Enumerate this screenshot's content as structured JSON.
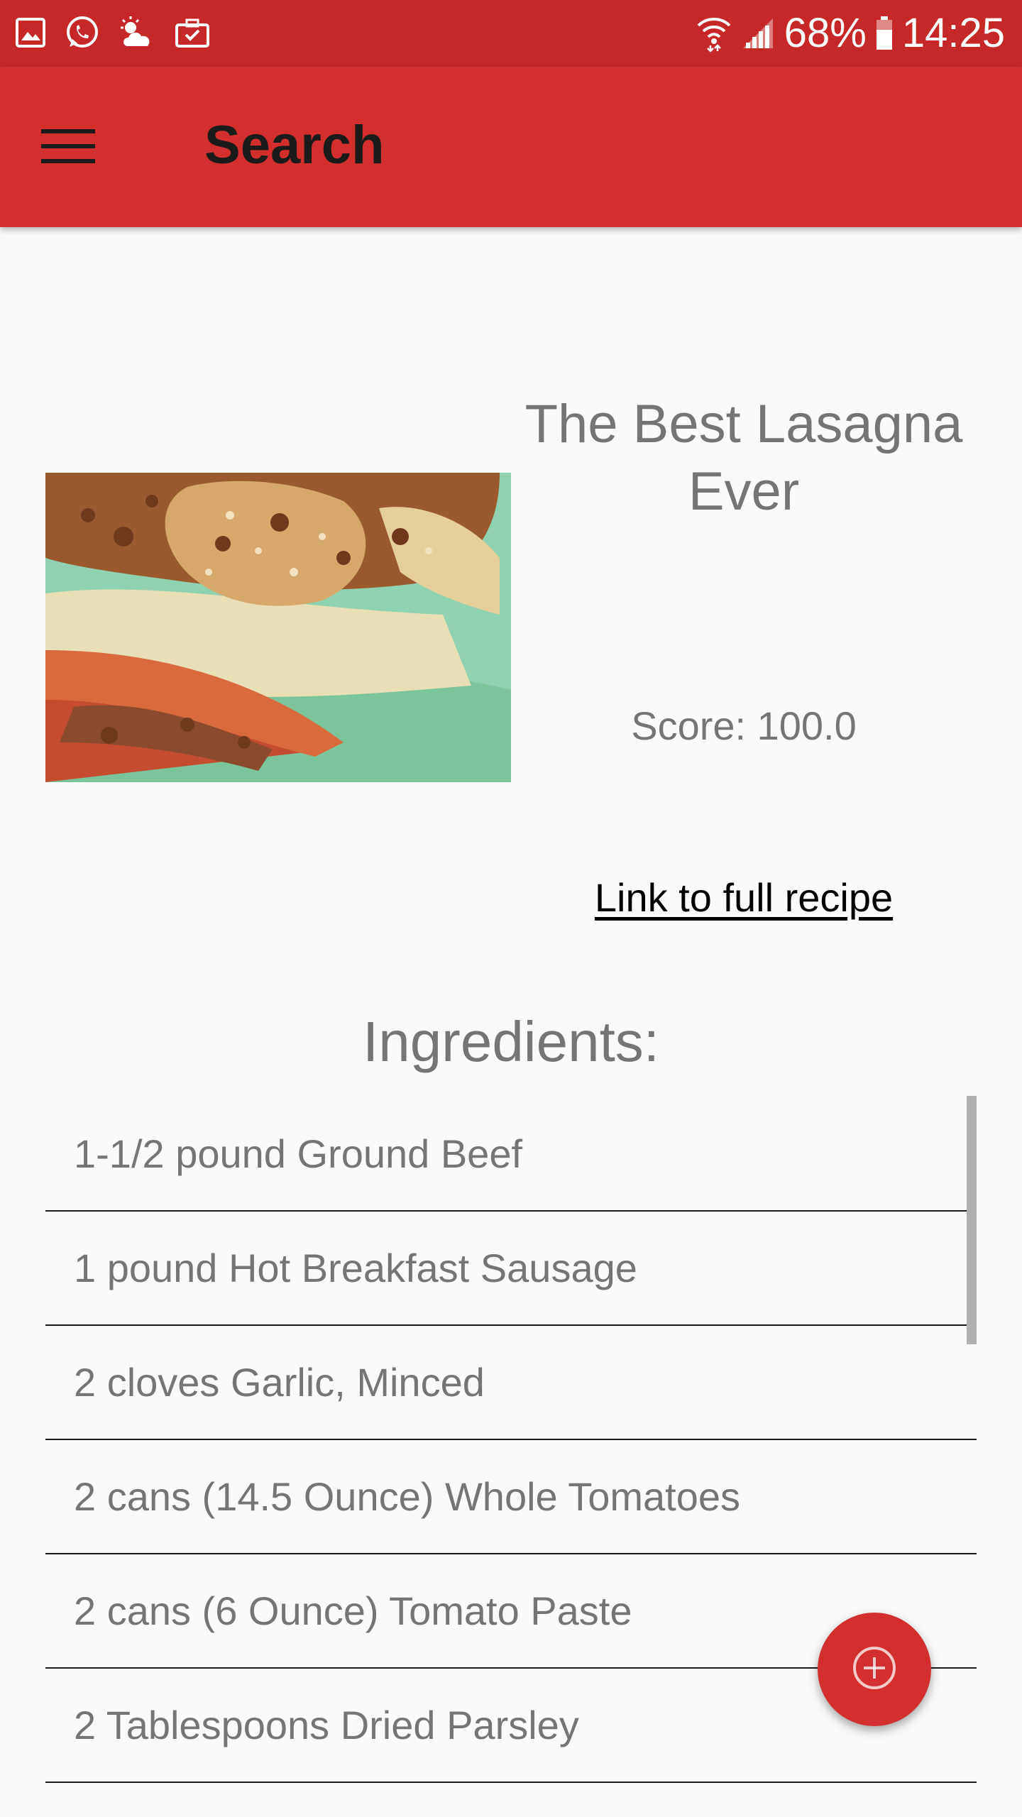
{
  "status_bar": {
    "battery": "68%",
    "time": "14:25",
    "left_icons": [
      "gallery-icon",
      "whatsapp-icon",
      "weather-icon",
      "briefcase-icon"
    ],
    "right_icons": [
      "wifi-icon",
      "signal-icon",
      "battery-icon"
    ]
  },
  "toolbar": {
    "title": "Search",
    "menu_icon": "hamburger-menu-icon"
  },
  "recipe": {
    "title": "The Best Lasagna Ever",
    "score": "Score: 100.0",
    "link_label": "Link to full recipe",
    "image": "lasagna-photo"
  },
  "ingredients": {
    "heading": "Ingredients:",
    "items": [
      "1-1/2 pound Ground Beef",
      "1 pound Hot Breakfast Sausage",
      "2 cloves Garlic, Minced",
      "2 cans (14.5 Ounce) Whole Tomatoes",
      "2 cans (6 Ounce) Tomato Paste",
      "2 Tablespoons Dried Parsley"
    ]
  },
  "fab": {
    "icon": "add-circle-icon"
  },
  "colors": {
    "status_bar": "#c62828",
    "toolbar": "#d32f2f",
    "fab": "#d32f2f",
    "text_secondary": "#757575",
    "background": "#fafafa"
  }
}
